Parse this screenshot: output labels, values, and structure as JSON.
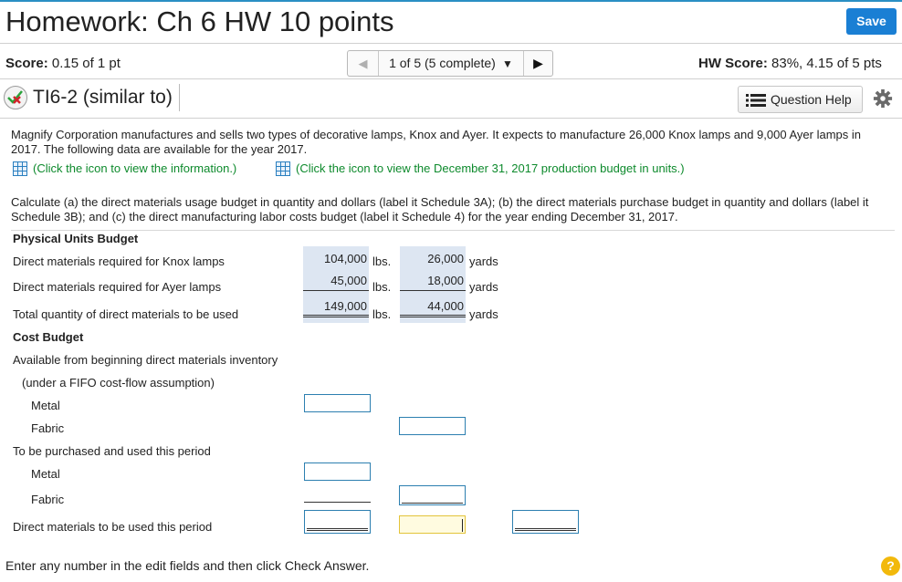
{
  "header": {
    "title": "Homework: Ch 6 HW 10 points",
    "save_label": "Save"
  },
  "score_bar": {
    "score_label": "Score:",
    "score_value": "0.15 of 1 pt",
    "nav_label": "1 of 5 (5 complete)",
    "hw_score_label": "HW Score:",
    "hw_score_value": "83%, 4.15 of 5 pts"
  },
  "question": {
    "name": "TI6-2 (similar to)",
    "help_label": "Question Help"
  },
  "problem": {
    "intro": "Magnify Corporation manufactures and sells two types of decorative lamps, Knox and Ayer. It expects to manufacture 26,000 Knox lamps and 9,000 Ayer lamps in 2017. The following data are available for the year 2017.",
    "link1": "(Click the icon to view the information.)",
    "link2": "(Click the icon to view the December 31, 2017 production budget in units.)",
    "task": "Calculate (a) the direct materials usage budget in quantity and dollars (label it Schedule 3A); (b) the direct materials purchase budget in quantity and dollars (label it Schedule 3B); and (c) the direct manufacturing labor costs budget (label it Schedule 4) for the year ending December 31, 2017."
  },
  "budget": {
    "physical_header": "Physical Units Budget",
    "rows": [
      {
        "label": "Direct materials required for Knox lamps",
        "metal": "104,000",
        "metal_unit": "lbs.",
        "fabric": "26,000",
        "fabric_unit": "yards"
      },
      {
        "label": "Direct materials required for Ayer lamps",
        "metal": "45,000",
        "metal_unit": "lbs.",
        "fabric": "18,000",
        "fabric_unit": "yards"
      },
      {
        "label": "Total quantity of direct materials to be used",
        "metal": "149,000",
        "metal_unit": "lbs.",
        "fabric": "44,000",
        "fabric_unit": "yards"
      }
    ],
    "cost_header": "Cost Budget",
    "cost_rows": [
      "Available from beginning direct materials inventory",
      "(under a FIFO cost-flow assumption)",
      "Metal",
      "Fabric",
      "To be purchased and used this period",
      "Metal",
      "Fabric",
      "Direct materials to be used this period"
    ]
  },
  "footer": {
    "instruction": "Enter any number in the edit fields and then click Check Answer.",
    "help_symbol": "?"
  },
  "colors": {
    "accent": "#1a7fd4",
    "link_green": "#0d8a2c",
    "cell_bg": "#dde6f2",
    "input_border": "#2c7fb0",
    "active_input": "#e3c43a"
  }
}
